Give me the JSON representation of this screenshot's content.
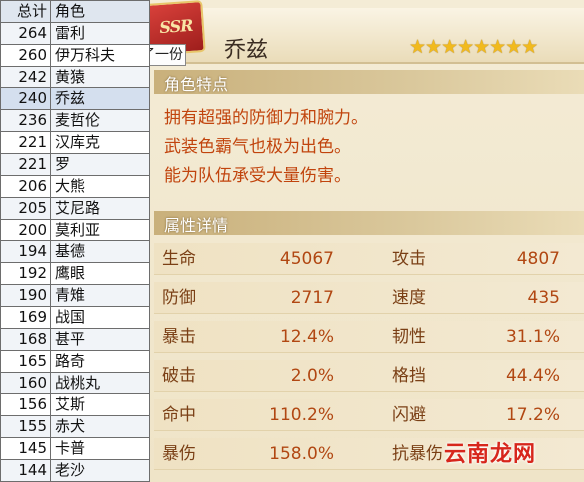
{
  "ranking_table": {
    "headers": {
      "score": "总计",
      "name": "角色"
    },
    "rows": [
      {
        "score": "264",
        "name": "雷利"
      },
      {
        "score": "260",
        "name": "伊万科夫"
      },
      {
        "score": "242",
        "name": "黄猿"
      },
      {
        "score": "240",
        "name": "乔兹"
      },
      {
        "score": "236",
        "name": "麦哲伦"
      },
      {
        "score": "221",
        "name": "汉库克"
      },
      {
        "score": "221",
        "name": "罗"
      },
      {
        "score": "206",
        "name": "大熊"
      },
      {
        "score": "205",
        "name": "艾尼路"
      },
      {
        "score": "200",
        "name": "莫利亚"
      },
      {
        "score": "194",
        "name": "基德"
      },
      {
        "score": "192",
        "name": "鹰眼"
      },
      {
        "score": "190",
        "name": "青雉"
      },
      {
        "score": "169",
        "name": "战国"
      },
      {
        "score": "168",
        "name": "甚平"
      },
      {
        "score": "165",
        "name": "路奇"
      },
      {
        "score": "160",
        "name": "战桃丸"
      },
      {
        "score": "156",
        "name": "艾斯"
      },
      {
        "score": "155",
        "name": "赤犬"
      },
      {
        "score": "145",
        "name": "卡普"
      },
      {
        "score": "144",
        "name": "老沙"
      }
    ],
    "overlap_fragment": "了一份"
  },
  "character": {
    "rarity": "SSR",
    "name": "乔兹",
    "stars": "★★★★★★★★",
    "star_count": 8
  },
  "traits": {
    "header": "角色特点",
    "lines": [
      "拥有超强的防御力和腕力。",
      "武装色霸气也极为出色。",
      "能为队伍承受大量伤害。"
    ]
  },
  "stats": {
    "header": "属性详情",
    "rows": [
      {
        "label1": "生命",
        "value1": "45067",
        "label2": "攻击",
        "value2": "4807"
      },
      {
        "label1": "防御",
        "value1": "2717",
        "label2": "速度",
        "value2": "435"
      },
      {
        "label1": "暴击",
        "value1": "12.4%",
        "label2": "韧性",
        "value2": "31.1%"
      },
      {
        "label1": "破击",
        "value1": "2.0%",
        "label2": "格挡",
        "value2": "44.4%"
      },
      {
        "label1": "命中",
        "value1": "110.2%",
        "label2": "闪避",
        "value2": "17.2%"
      },
      {
        "label1": "暴伤",
        "value1": "158.0%",
        "label2": "抗暴伤",
        "value2": ""
      }
    ]
  },
  "watermark": "云南龙网",
  "colors": {
    "trait_text": "#c1440d",
    "stat_label": "#7a3f15",
    "stat_value": "#b14712",
    "star": "#f1ba1e",
    "badge": "#c0302b"
  }
}
